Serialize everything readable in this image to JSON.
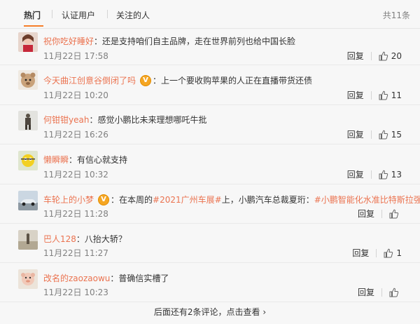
{
  "tabs": [
    "热门",
    "认证用户",
    "关注的人"
  ],
  "total": "共11条",
  "comments": [
    {
      "user": "祝你吃好睡好",
      "badge": "",
      "text_pre": "：还是支持咱们自主品牌，走在世界前列也给中国长脸",
      "hashtag1": "",
      "text_mid": "",
      "hashtag2": "",
      "time": "11月22日 17:58",
      "reply": "回复",
      "likes": "20"
    },
    {
      "user": "今天曲江创意谷倒闭了吗",
      "badge": "V",
      "text_pre": "：上一个要收购苹果的人正在直播带货还债",
      "hashtag1": "",
      "text_mid": "",
      "hashtag2": "",
      "time": "11月22日 10:20",
      "reply": "回复",
      "likes": "11"
    },
    {
      "user": "何钳钳yeah",
      "badge": "",
      "text_pre": "：感觉小鹏比未来理想哪吒牛批",
      "hashtag1": "",
      "text_mid": "",
      "hashtag2": "",
      "time": "11月22日 16:26",
      "reply": "回复",
      "likes": "15"
    },
    {
      "user": "懒瞬瞬",
      "badge": "",
      "text_pre": "：有信心就支持",
      "hashtag1": "",
      "text_mid": "",
      "hashtag2": "",
      "time": "11月22日 10:32",
      "reply": "回复",
      "likes": "13"
    },
    {
      "user": "车轮上的小梦",
      "badge": "V",
      "text_pre": "：在本周的",
      "hashtag1": "#2021广州车展#",
      "text_mid": "上，小鹏汽车总裁夏珩：",
      "hashtag2": "#小鹏智能化水准比特斯拉强#",
      "time": "11月22日 11:28",
      "reply": "回复",
      "likes": ""
    },
    {
      "user": "巴人128",
      "badge": "",
      "text_pre": "：八抬大轿？",
      "hashtag1": "",
      "text_mid": "",
      "hashtag2": "",
      "time": "11月22日 11:27",
      "reply": "回复",
      "likes": "1"
    },
    {
      "user": "改名的zaozaowu",
      "badge": "",
      "text_pre": "：普确信实槽了",
      "hashtag1": "",
      "text_mid": "",
      "hashtag2": "",
      "time": "11月22日 10:23",
      "reply": "回复",
      "likes": ""
    }
  ],
  "footer": "后面还有2条评论，点击查看 ›",
  "colors": {
    "accent": "#eb7350",
    "tab_underline": "#f67e2a",
    "badge": "#f5a623"
  }
}
